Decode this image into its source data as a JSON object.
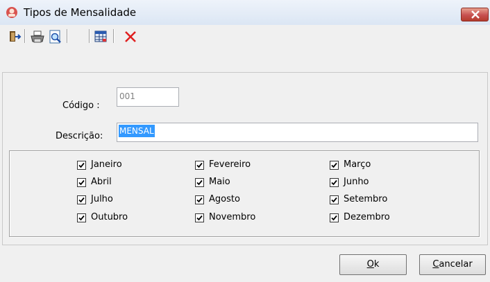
{
  "window": {
    "title": "Tipos de Mensalidade"
  },
  "toolbar": {
    "icons": [
      "exit-icon",
      "printer-icon",
      "print-preview-icon",
      "grid-view-icon",
      "delete-icon"
    ],
    "delete_color": "#e02020"
  },
  "form": {
    "codigo_label": "Código :",
    "codigo_value": "001",
    "descricao_label": "Descrição:",
    "descricao_value": "MENSAL"
  },
  "months": [
    {
      "label": "Janeiro",
      "checked": true
    },
    {
      "label": "Fevereiro",
      "checked": true
    },
    {
      "label": "Março",
      "checked": true
    },
    {
      "label": "Abril",
      "checked": true
    },
    {
      "label": "Maio",
      "checked": true
    },
    {
      "label": "Junho",
      "checked": true
    },
    {
      "label": "Julho",
      "checked": true
    },
    {
      "label": "Agosto",
      "checked": true
    },
    {
      "label": "Setembro",
      "checked": true
    },
    {
      "label": "Outubro",
      "checked": true
    },
    {
      "label": "Novembro",
      "checked": true
    },
    {
      "label": "Dezembro",
      "checked": true
    }
  ],
  "buttons": {
    "ok_key": "O",
    "ok_rest": "k",
    "cancel_key": "C",
    "cancel_rest": "ancelar"
  },
  "colors": {
    "selection": "#3399ff",
    "close_button": "#c75050"
  }
}
